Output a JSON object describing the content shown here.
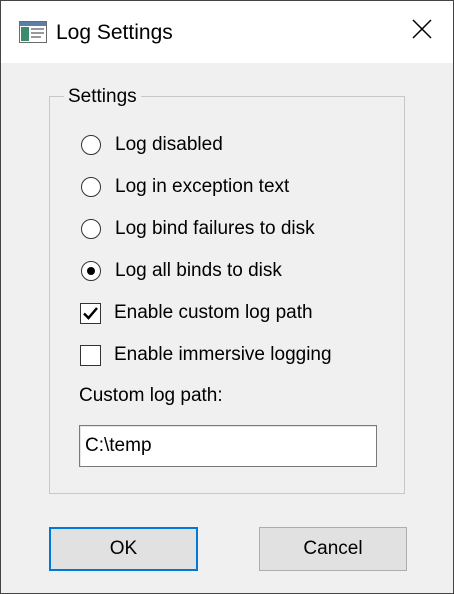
{
  "window": {
    "title": "Log Settings",
    "app_icon": "log-settings-app-icon",
    "close_icon": "close-icon"
  },
  "settings_group": {
    "legend": "Settings",
    "radio_options": [
      {
        "label": "Log disabled",
        "selected": false
      },
      {
        "label": "Log in exception text",
        "selected": false
      },
      {
        "label": "Log bind failures to disk",
        "selected": false
      },
      {
        "label": "Log all binds to disk",
        "selected": true
      }
    ],
    "checkboxes": [
      {
        "label": "Enable custom log path",
        "checked": true
      },
      {
        "label": "Enable immersive logging",
        "checked": false
      }
    ],
    "custom_log_path": {
      "label": "Custom log path:",
      "value": "C:\\temp"
    }
  },
  "buttons": {
    "ok": "OK",
    "cancel": "Cancel"
  },
  "colors": {
    "dialog_background": "#f0f0f0",
    "titlebar_background": "#ffffff",
    "default_button_border": "#0078d7",
    "button_face": "#e1e1e1"
  }
}
